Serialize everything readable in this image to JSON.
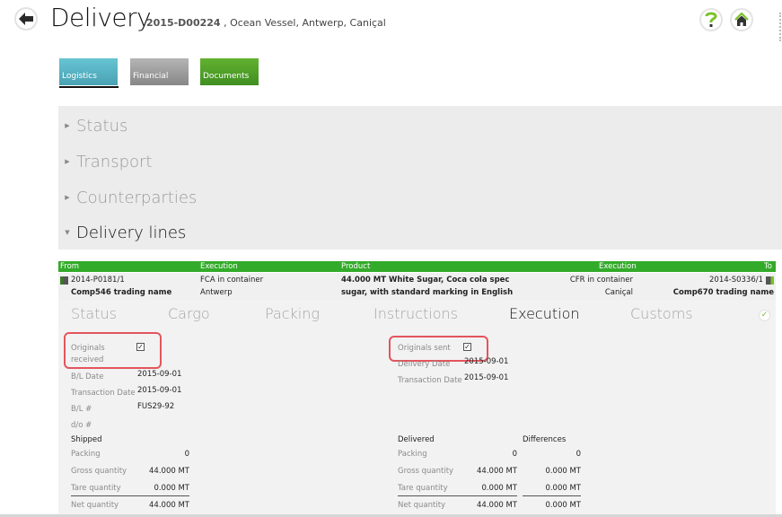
{
  "header": {
    "title": "Delivery",
    "record_id": "2015-D00224",
    "record_details": " , Ocean Vessel, Antwerp, Caniçal",
    "help_icon": "question-mark-icon",
    "home_icon": "home-icon",
    "back_icon": "back-arrow-icon"
  },
  "modules": [
    {
      "label": "Logistics",
      "color": "#4fa9ba",
      "active": true
    },
    {
      "label": "Financial",
      "color": "#999999",
      "active": false
    },
    {
      "label": "Documents",
      "color": "#4a9d28",
      "active": false
    }
  ],
  "sections": [
    {
      "label": "Status",
      "expanded": false
    },
    {
      "label": "Transport",
      "expanded": false
    },
    {
      "label": "Counterparties",
      "expanded": false
    },
    {
      "label": "Delivery lines",
      "expanded": true
    }
  ],
  "delivery_lines": {
    "header_color": "#33ab2a",
    "columns": [
      "From",
      "Execution",
      "Product",
      "Execution",
      "To"
    ],
    "rows": [
      {
        "from_ref": "2014-P0181/1",
        "from_company": "Comp546 trading name",
        "from_execution": "FCA in container",
        "from_location": "Antwerp",
        "product_line1": "44.000 MT White Sugar, Coca cola spec",
        "product_line2": "sugar, with standard marking in English",
        "to_execution": "CFR in container",
        "to_location": "Caniçal",
        "to_ref": "2014-S0336/1",
        "to_company": "Comp670 trading name"
      }
    ]
  },
  "detail_tabs": [
    {
      "label": "Status",
      "active": false
    },
    {
      "label": "Cargo",
      "active": false
    },
    {
      "label": "Packing",
      "active": false
    },
    {
      "label": "Instructions",
      "active": false
    },
    {
      "label": "Execution",
      "active": true
    },
    {
      "label": "Customs",
      "active": false
    }
  ],
  "completion_icon": "checkmark-icon",
  "execution": {
    "left": {
      "originals_received_label": "Originals received",
      "originals_received_line1": "Originals",
      "originals_received_line2": "received",
      "originals_received": true,
      "fields": [
        {
          "label": "B/L Date",
          "value": "2015-09-01"
        },
        {
          "label": "Transaction Date",
          "value": "2015-09-01"
        },
        {
          "label": "B/L #",
          "value": "FUS29-92"
        },
        {
          "label": "d/o #",
          "value": ""
        }
      ]
    },
    "right": {
      "originals_sent_label": "Originals sent",
      "originals_sent": true,
      "fields": [
        {
          "label": "Delivery Date",
          "value": "2015-09-01"
        },
        {
          "label": "Transaction Date",
          "value": "2015-09-01"
        }
      ]
    },
    "shipped": {
      "title": "Shipped",
      "rows": [
        {
          "label": "Packing",
          "value": "0"
        },
        {
          "label": "Gross quantity",
          "value": "44.000 MT"
        },
        {
          "label": "Tare quantity",
          "value": "0.000 MT"
        },
        {
          "label": "Net quantity",
          "value": "44.000 MT"
        }
      ]
    },
    "delivered": {
      "title": "Delivered",
      "rows": [
        {
          "label": "Packing",
          "value": "0"
        },
        {
          "label": "Gross quantity",
          "value": "44.000 MT"
        },
        {
          "label": "Tare quantity",
          "value": "0.000 MT"
        },
        {
          "label": "Net quantity",
          "value": "44.000 MT"
        }
      ]
    },
    "differences": {
      "title": "Differences",
      "values": [
        "0",
        "0.000 MT",
        "0.000 MT",
        "0.000 MT"
      ]
    }
  }
}
